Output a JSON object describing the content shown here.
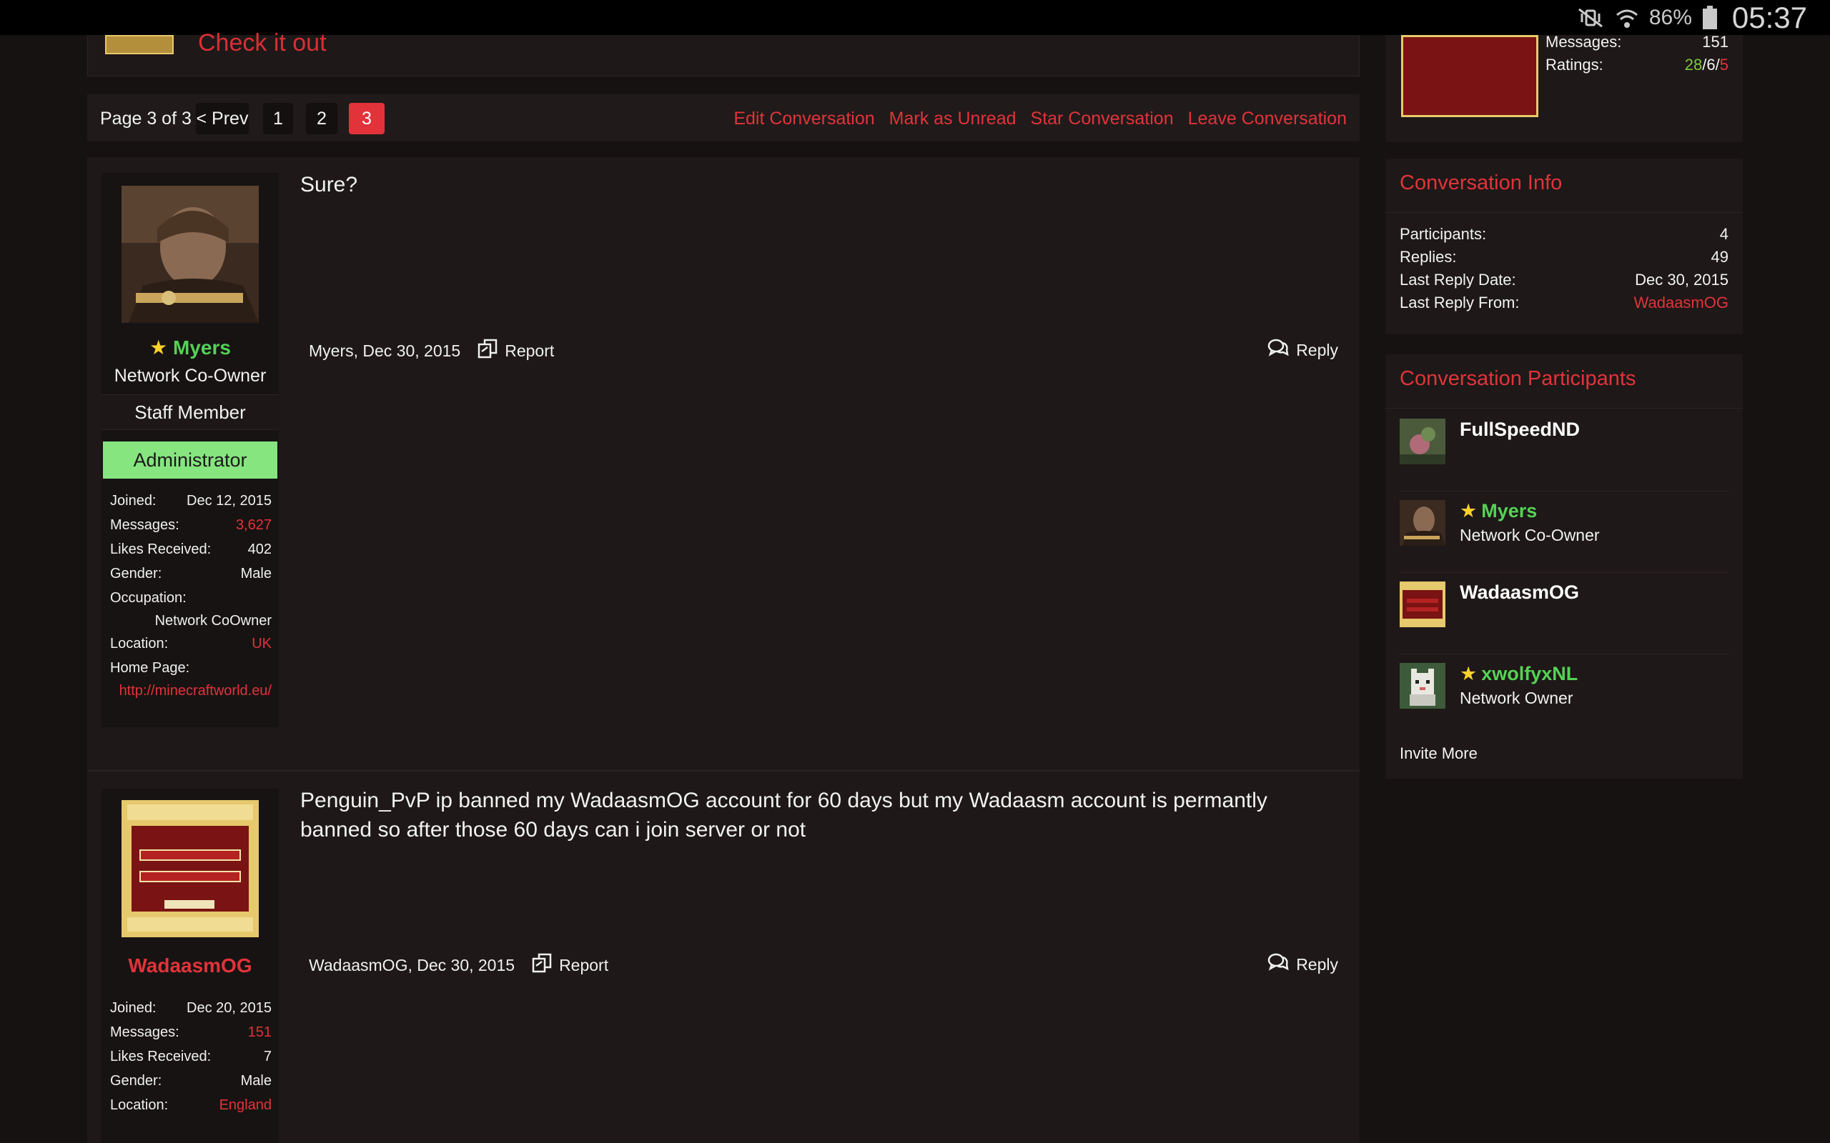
{
  "status_bar": {
    "battery": "86%",
    "time": "05:37",
    "icons": [
      "mute-icon",
      "wifi-icon",
      "battery-icon"
    ]
  },
  "top_box": {
    "link_text": "Check it out"
  },
  "pagination": {
    "page_text": "Page 3 of 3",
    "prev": "< Prev",
    "pages": [
      "1",
      "2",
      "3"
    ],
    "current": "3"
  },
  "actions": {
    "edit": "Edit Conversation",
    "mark_unread": "Mark as Unread",
    "star": "Star Conversation",
    "leave": "Leave Conversation"
  },
  "messages": [
    {
      "text": "Sure?",
      "author": "Myers",
      "user_title": "Network Co-Owner",
      "staff_label": "Staff Member",
      "admin_label": "Administrator",
      "meta": "Myers, Dec 30, 2015",
      "report": "Report",
      "reply": "Reply",
      "details": {
        "joined_label": "Joined:",
        "joined": "Dec 12, 2015",
        "messages_label": "Messages:",
        "messages": "3,627",
        "likes_label": "Likes Received:",
        "likes": "402",
        "gender_label": "Gender:",
        "gender": "Male",
        "occupation_label": "Occupation:",
        "occupation": "Network CoOwner",
        "location_label": "Location:",
        "location": "UK",
        "homepage_label": "Home Page:",
        "homepage": "http://minecraftworld.eu/"
      }
    },
    {
      "text": "Penguin_PvP ip banned my WadaasmOG account for 60 days but my Wadaasm account is permantly banned so after those 60 days can i join server or not",
      "author": "WadaasmOG",
      "meta": "WadaasmOG, Dec 30, 2015",
      "report": "Report",
      "reply": "Reply",
      "details": {
        "joined_label": "Joined:",
        "joined": "Dec 20, 2015",
        "messages_label": "Messages:",
        "messages": "151",
        "likes_label": "Likes Received:",
        "likes": "7",
        "gender_label": "Gender:",
        "gender": "Male",
        "location_label": "Location:",
        "location": "England"
      }
    }
  ],
  "sidebar": {
    "top_stats": {
      "messages_label": "Messages:",
      "messages": "151",
      "ratings_label": "Ratings:",
      "ratings_pos": "28",
      "ratings_neutral": "6",
      "ratings_neg": "5"
    },
    "conversation_info": {
      "title": "Conversation Info",
      "participants_label": "Participants:",
      "participants": "4",
      "replies_label": "Replies:",
      "replies": "49",
      "last_reply_date_label": "Last Reply Date:",
      "last_reply_date": "Dec 30, 2015",
      "last_reply_from_label": "Last Reply From:",
      "last_reply_from": "WadaasmOG"
    },
    "participants": {
      "title": "Conversation Participants",
      "list": [
        {
          "name": "FullSpeedND",
          "title": ""
        },
        {
          "name": "Myers",
          "title": "Network Co-Owner"
        },
        {
          "name": "WadaasmOG",
          "title": ""
        },
        {
          "name": "xwolfyxNL",
          "title": "Network Owner"
        }
      ],
      "invite": "Invite More"
    }
  },
  "colors": {
    "accent": "#e2333a",
    "staff_green": "#55d255",
    "admin_bg": "#86e57f",
    "background": "#171212",
    "panel": "#1e1818"
  }
}
